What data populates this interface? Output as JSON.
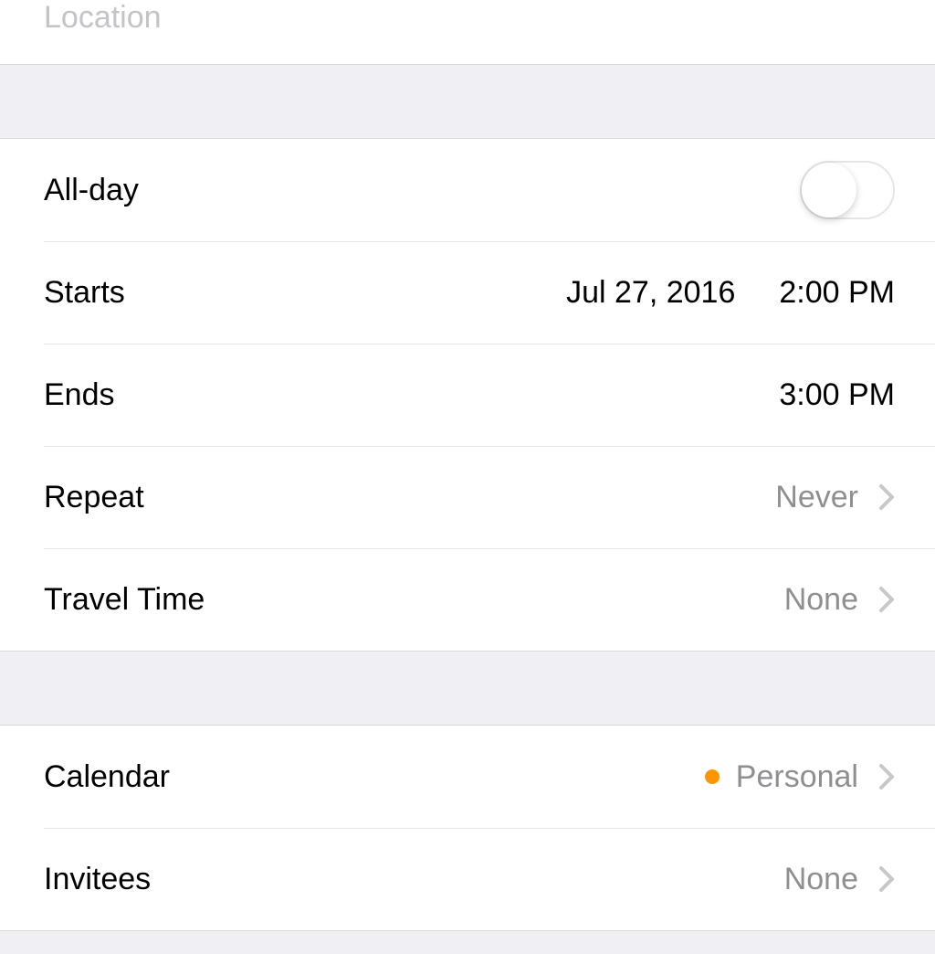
{
  "location": {
    "placeholder": "Location"
  },
  "timing": {
    "allday_label": "All-day",
    "allday_on": false,
    "starts_label": "Starts",
    "starts_date": "Jul 27, 2016",
    "starts_time": "2:00 PM",
    "ends_label": "Ends",
    "ends_time": "3:00 PM",
    "repeat_label": "Repeat",
    "repeat_value": "Never",
    "travel_label": "Travel Time",
    "travel_value": "None"
  },
  "details": {
    "calendar_label": "Calendar",
    "calendar_value": "Personal",
    "calendar_color": "#ff9500",
    "invitees_label": "Invitees",
    "invitees_value": "None"
  }
}
